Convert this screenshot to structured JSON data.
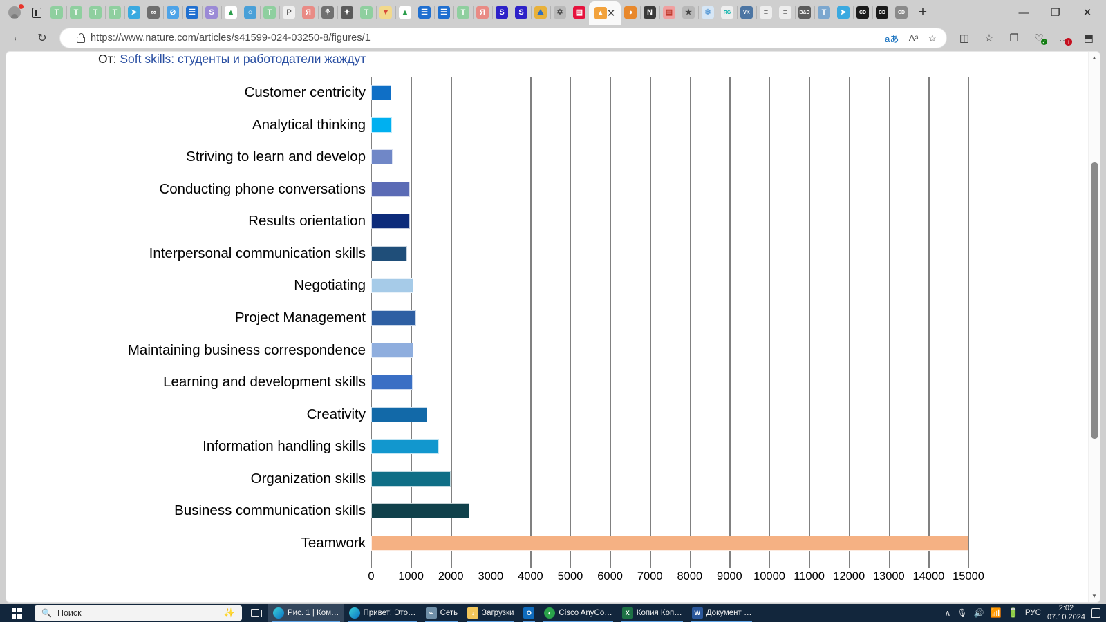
{
  "browser": {
    "tabs": [
      {
        "name": "tab-tinkoff-1",
        "glyph": "T",
        "bg": "#8fcf9f",
        "fg": "#ffffff"
      },
      {
        "name": "tab-tinkoff-2",
        "glyph": "T",
        "bg": "#8fcf9f",
        "fg": "#ffffff"
      },
      {
        "name": "tab-tinkoff-3",
        "glyph": "T",
        "bg": "#8fcf9f",
        "fg": "#ffffff"
      },
      {
        "name": "tab-tinkoff-4",
        "glyph": "T",
        "bg": "#8fcf9f",
        "fg": "#ffffff"
      },
      {
        "name": "tab-telegram",
        "glyph": "➤",
        "bg": "#3aa9e0",
        "fg": "#ffffff"
      },
      {
        "name": "tab-cyberleninka",
        "glyph": "∞",
        "bg": "#6e6e6e",
        "fg": "#ffffff"
      },
      {
        "name": "tab-zen",
        "glyph": "⊘",
        "bg": "#4da3e8",
        "fg": "#ffffff"
      },
      {
        "name": "tab-document-1",
        "glyph": "☰",
        "bg": "#1f6fd0",
        "fg": "#ffffff"
      },
      {
        "name": "tab-sber",
        "glyph": "S",
        "bg": "#9b8ad6",
        "fg": "#ffffff"
      },
      {
        "name": "tab-drive-1",
        "glyph": "▲",
        "bg": "#ffffff",
        "fg": "#2a9d4a"
      },
      {
        "name": "tab-messenger",
        "glyph": "○",
        "bg": "#49a0d8",
        "fg": "#ffffff"
      },
      {
        "name": "tab-tinkoff-5",
        "glyph": "T",
        "bg": "#8fcf9f",
        "fg": "#ffffff"
      },
      {
        "name": "tab-rp-journal",
        "glyph": "P",
        "bg": "#efefef",
        "fg": "#555555"
      },
      {
        "name": "tab-yandex-1",
        "glyph": "Я",
        "bg": "#e98b85",
        "fg": "#ffffff"
      },
      {
        "name": "tab-elibrary",
        "glyph": "⚘",
        "bg": "#707070",
        "fg": "#ffffff"
      },
      {
        "name": "tab-scholar",
        "glyph": "✦",
        "bg": "#5a5a5a",
        "fg": "#ffffff"
      },
      {
        "name": "tab-tinkoff-6",
        "glyph": "T",
        "bg": "#8fcf9f",
        "fg": "#ffffff"
      },
      {
        "name": "tab-mail",
        "glyph": "▼",
        "bg": "#f2d98c",
        "fg": "#d84b3a"
      },
      {
        "name": "tab-drive-2",
        "glyph": "▲",
        "bg": "#ffffff",
        "fg": "#2a9d4a"
      },
      {
        "name": "tab-document-2",
        "glyph": "☰",
        "bg": "#1f6fd0",
        "fg": "#ffffff"
      },
      {
        "name": "tab-document-3",
        "glyph": "☰",
        "bg": "#1f6fd0",
        "fg": "#ffffff"
      },
      {
        "name": "tab-tinkoff-7",
        "glyph": "T",
        "bg": "#8fcf9f",
        "fg": "#ffffff"
      },
      {
        "name": "tab-yandex-2",
        "glyph": "Я",
        "bg": "#e98b85",
        "fg": "#ffffff"
      },
      {
        "name": "tab-sber-2",
        "glyph": "S",
        "bg": "#2d21c8",
        "fg": "#ffffff"
      },
      {
        "name": "tab-sber-3",
        "glyph": "S",
        "bg": "#2d21c8",
        "fg": "#ffffff"
      },
      {
        "name": "tab-gallery",
        "glyph": "⛰",
        "bg": "#e8b13a",
        "fg": "#2f6fbf"
      },
      {
        "name": "tab-article-sketch",
        "glyph": "✡",
        "bg": "#b9b9b9",
        "fg": "#444444"
      },
      {
        "name": "tab-nature-red",
        "glyph": "▤",
        "bg": "#e6123d",
        "fg": "#ffffff"
      }
    ],
    "active_tab": {
      "name": "tab-nature-active",
      "glyph": "▲",
      "bg": "#f2a23c",
      "fg": "#ffffff"
    },
    "tabs_after": [
      {
        "name": "tab-firefox",
        "glyph": "◑",
        "bg": "#e8882c",
        "fg": "#ffffff"
      },
      {
        "name": "tab-notion",
        "glyph": "N",
        "bg": "#3a3a3a",
        "fg": "#ffffff"
      },
      {
        "name": "tab-excel-sheet",
        "glyph": "▤",
        "bg": "#f0a0a0",
        "fg": "#c0392b"
      },
      {
        "name": "tab-favorite-star",
        "glyph": "★",
        "bg": "#b8b8b8",
        "fg": "#444444"
      },
      {
        "name": "tab-snowflake",
        "glyph": "❄",
        "bg": "#d6e6f5",
        "fg": "#5a9bd6"
      },
      {
        "name": "tab-researchgate",
        "glyph": "RG",
        "bg": "#eeeeee",
        "fg": "#00b0a8"
      },
      {
        "name": "tab-vk",
        "glyph": "VK",
        "bg": "#4c75a3",
        "fg": "#ffffff"
      },
      {
        "name": "tab-portal-1",
        "glyph": "≡",
        "bg": "#ededed",
        "fg": "#666666"
      },
      {
        "name": "tab-portal-2",
        "glyph": "≡",
        "bg": "#ededed",
        "fg": "#666666"
      },
      {
        "name": "tab-bnd",
        "glyph": "B&D",
        "bg": "#5c5c5c",
        "fg": "#ffffff"
      },
      {
        "name": "tab-t-letter",
        "glyph": "T",
        "bg": "#7ba7cf",
        "fg": "#ffffff"
      },
      {
        "name": "tab-telegram-2",
        "glyph": "➤",
        "bg": "#3aa9e0",
        "fg": "#ffffff"
      },
      {
        "name": "tab-cd-1",
        "glyph": "CD",
        "bg": "#1a1a1a",
        "fg": "#ffffff"
      },
      {
        "name": "tab-cd-2",
        "glyph": "CD",
        "bg": "#1a1a1a",
        "fg": "#ffffff"
      },
      {
        "name": "tab-cd-3",
        "glyph": "CD",
        "bg": "#8a8a8a",
        "fg": "#ffffff"
      }
    ],
    "new_tab_label": "+",
    "window_controls": {
      "minimize": "—",
      "maximize": "❐",
      "close": "✕"
    },
    "nav": {
      "back": "←",
      "refresh": "↻"
    },
    "url": "https://www.nature.com/articles/s41599-024-03250-8/figures/1",
    "omnibox_icons": [
      {
        "name": "translate-icon",
        "glyph": "aあ"
      },
      {
        "name": "read-aloud-icon",
        "glyph": "Aˢ"
      },
      {
        "name": "favorite-add-icon",
        "glyph": "☆"
      }
    ],
    "toolbar_icons": [
      {
        "name": "split-screen-icon",
        "glyph": "◫"
      },
      {
        "name": "favorites-icon",
        "glyph": "☆"
      },
      {
        "name": "collections-icon",
        "glyph": "❐"
      },
      {
        "name": "browser-essentials-icon",
        "glyph": "♡"
      },
      {
        "name": "settings-more-icon",
        "glyph": "…"
      },
      {
        "name": "sidebar-toggle-icon",
        "glyph": "⬒"
      }
    ]
  },
  "page": {
    "from_prefix": "От: ",
    "from_link": "Soft skills: студенты и работодатели жаждут"
  },
  "chart_data": {
    "type": "bar",
    "orientation": "horizontal",
    "title": "",
    "xlabel": "",
    "ylabel": "",
    "xlim": [
      0,
      15000
    ],
    "xticks": [
      0,
      1000,
      2000,
      3000,
      4000,
      5000,
      6000,
      7000,
      8000,
      9000,
      10000,
      11000,
      12000,
      13000,
      14000,
      15000
    ],
    "xtick_labels": [
      "0",
      "1000",
      "2000",
      "3000",
      "4000",
      "5000",
      "6000",
      "7000",
      "8000",
      "9000",
      "10000",
      "11000",
      "12000",
      "13000",
      "14000",
      "15000"
    ],
    "grid": true,
    "grid_axis": "x",
    "legend": "none",
    "categories": [
      "Customer centricity",
      "Analytical thinking",
      "Striving to learn and develop",
      "Conducting phone conversations",
      "Results orientation",
      "Interpersonal communication skills",
      "Negotiating",
      "Project Management",
      "Maintaining business correspondence",
      "Learning and development skills",
      "Creativity",
      "Information handling skills",
      "Organization skills",
      "Business communication skills",
      "Teamwork"
    ],
    "values": [
      500,
      520,
      540,
      980,
      980,
      900,
      1060,
      1120,
      1060,
      1050,
      1400,
      1700,
      2000,
      2470,
      15000
    ],
    "colors": [
      "#0f6fc6",
      "#00b0f0",
      "#7087c7",
      "#5b6bb5",
      "#0d2b7a",
      "#1f4e79",
      "#a6cbe8",
      "#2e5fa3",
      "#8faede",
      "#3a6fc4",
      "#1269a8",
      "#1297ce",
      "#0f6e86",
      "#10414b",
      "#f5b183"
    ]
  },
  "taskbar": {
    "start_label": "Start",
    "search_placeholder": "Поиск",
    "task_view_label": "Task view",
    "apps": [
      {
        "name": "taskbar-app-edge-figure",
        "label": "Рис. 1 | Ком…",
        "icon": "edge",
        "active": true
      },
      {
        "name": "taskbar-app-edge-privet",
        "label": "Привет! Это…",
        "icon": "edge",
        "active": false
      },
      {
        "name": "taskbar-app-network",
        "label": "Сеть",
        "icon": "network",
        "active": false
      },
      {
        "name": "taskbar-app-downloads",
        "label": "Загрузки",
        "icon": "folder",
        "active": false
      },
      {
        "name": "taskbar-app-outlook",
        "label": "",
        "icon": "outlook",
        "active": false
      },
      {
        "name": "taskbar-app-cisco",
        "label": "Cisco AnyCo…",
        "icon": "cisco",
        "active": false
      },
      {
        "name": "taskbar-app-excel",
        "label": "Копия Коп…",
        "icon": "excel",
        "active": false
      },
      {
        "name": "taskbar-app-word",
        "label": "Документ …",
        "icon": "word",
        "active": false
      }
    ],
    "tray": {
      "overflow": "∧",
      "mic": "🎙",
      "volume": "🔊",
      "wifi": "◡",
      "battery": "▭",
      "language": "РУС",
      "time": "2:02",
      "date": "07.10.2024"
    }
  }
}
